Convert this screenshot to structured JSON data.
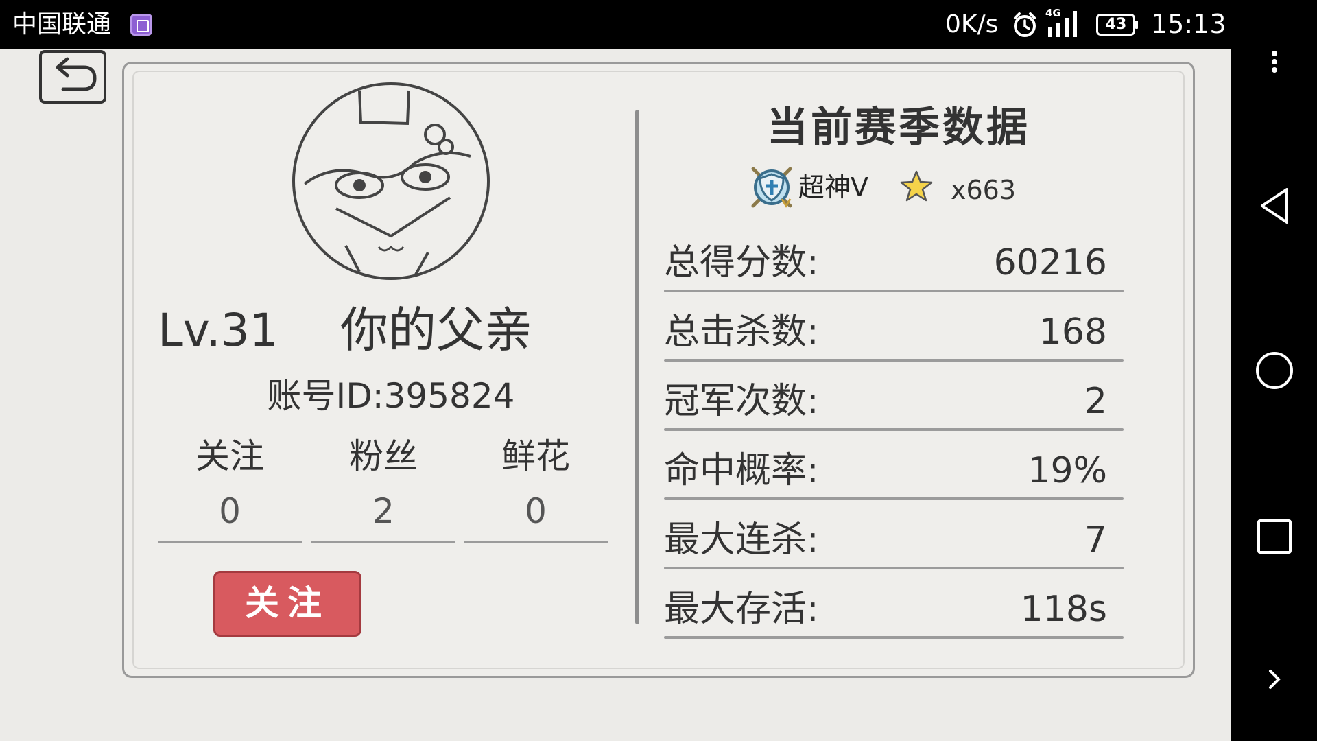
{
  "status_bar": {
    "carrier": "中国联通",
    "net_speed": "0K/s",
    "network": "4G",
    "battery": "43",
    "time": "15:13"
  },
  "profile": {
    "level": "Lv.31",
    "name": "你的父亲",
    "account_id": "账号ID:395824",
    "stats": [
      {
        "label": "关注",
        "value": "0"
      },
      {
        "label": "粉丝",
        "value": "2"
      },
      {
        "label": "鲜花",
        "value": "0"
      }
    ],
    "follow_button": "关注"
  },
  "season": {
    "title": "当前赛季数据",
    "rank": "超神V",
    "stars": "x663",
    "rows": [
      {
        "label": "总得分数:",
        "value": "60216"
      },
      {
        "label": "总击杀数:",
        "value": "168"
      },
      {
        "label": "冠军次数:",
        "value": "2"
      },
      {
        "label": "命中概率:",
        "value": "19%"
      },
      {
        "label": "最大连杀:",
        "value": "7"
      },
      {
        "label": "最大存活:",
        "value": "118s"
      }
    ]
  },
  "icons": {
    "back": "back-arrow-icon",
    "avatar": "cat-mask-avatar",
    "rank_badge": "shield-badge-icon",
    "star": "star-icon"
  },
  "colors": {
    "follow_button": "#d85a5f",
    "background": "#ecebe8"
  }
}
